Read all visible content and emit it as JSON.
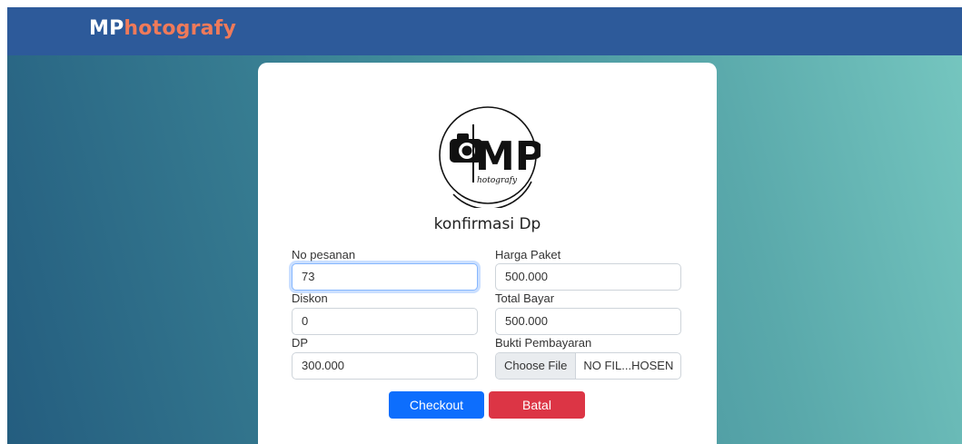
{
  "navbar": {
    "brand_prefix": "MP",
    "brand_suffix": "hotografy"
  },
  "form": {
    "title": "konfirmasi Dp",
    "logo_text": "hotografy",
    "fields": {
      "no_pesanan": {
        "label": "No pesanan",
        "value": "73"
      },
      "harga_paket": {
        "label": "Harga Paket",
        "value": "500.000"
      },
      "diskon": {
        "label": "Diskon",
        "value": "0"
      },
      "total_bayar": {
        "label": "Total Bayar",
        "value": "500.000"
      },
      "dp": {
        "label": "DP",
        "value": "300.000"
      },
      "bukti_pembayaran": {
        "label": "Bukti Pembayaran",
        "button_label": "Choose File",
        "file_name": "NO FIL...HOSEN"
      }
    },
    "buttons": {
      "checkout": "Checkout",
      "batal": "Batal"
    }
  },
  "colors": {
    "navbar": "#2d5a9a",
    "brand_accent": "#ef7a5a",
    "primary": "#0d6efd",
    "danger": "#dc3545"
  }
}
